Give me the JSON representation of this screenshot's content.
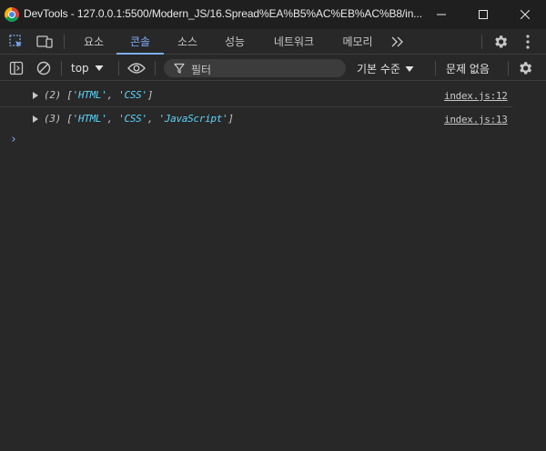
{
  "window": {
    "title": "DevTools - 127.0.0.1:5500/Modern_JS/16.Spread%EA%B5%AC%EB%AC%B8/in..."
  },
  "tabs": [
    {
      "label": "요소",
      "active": false
    },
    {
      "label": "콘솔",
      "active": true
    },
    {
      "label": "소스",
      "active": false
    },
    {
      "label": "성능",
      "active": false
    },
    {
      "label": "네트워크",
      "active": false
    },
    {
      "label": "메모리",
      "active": false
    }
  ],
  "toolbar": {
    "context": "top",
    "filter_placeholder": "필터",
    "levels": "기본 수준",
    "issues": "문제 없음"
  },
  "console": {
    "logs": [
      {
        "length": "(2)",
        "items": [
          "'HTML'",
          "'CSS'"
        ],
        "source": "index.js:12"
      },
      {
        "length": "(3)",
        "items": [
          "'HTML'",
          "'CSS'",
          "'JavaScript'"
        ],
        "source": "index.js:13"
      }
    ],
    "prompt": "›"
  },
  "colors": {
    "accent": "#7cacf8",
    "string": "#5cd5fb",
    "background": "#282828"
  }
}
